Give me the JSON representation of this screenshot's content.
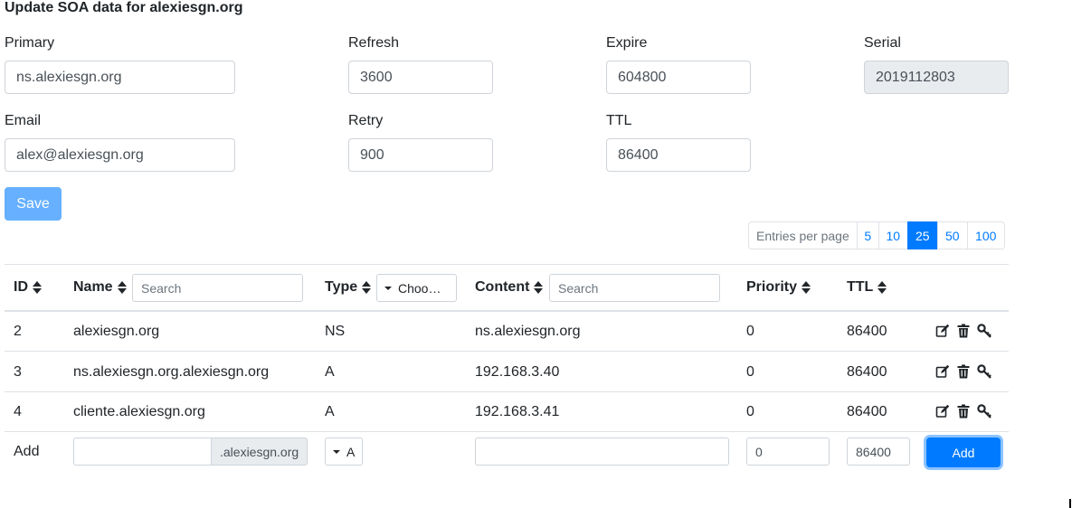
{
  "title": "Update SOA data for alexiesgn.org",
  "soa": {
    "primary": {
      "label": "Primary",
      "value": "ns.alexiesgn.org"
    },
    "refresh": {
      "label": "Refresh",
      "value": "3600"
    },
    "expire": {
      "label": "Expire",
      "value": "604800"
    },
    "serial": {
      "label": "Serial",
      "value": "2019112803"
    },
    "email": {
      "label": "Email",
      "value": "alex@alexiesgn.org"
    },
    "retry": {
      "label": "Retry",
      "value": "900"
    },
    "ttl": {
      "label": "TTL",
      "value": "86400"
    },
    "save_label": "Save"
  },
  "pager": {
    "label": "Entries per page",
    "options": [
      "5",
      "10",
      "25",
      "50",
      "100"
    ],
    "active": "25"
  },
  "table": {
    "headers": {
      "id": "ID",
      "name": "Name",
      "type": "Type",
      "content": "Content",
      "priority": "Priority",
      "ttl": "TTL"
    },
    "name_search_placeholder": "Search",
    "type_filter_label": "Choo…",
    "content_search_placeholder": "Search",
    "rows": [
      {
        "id": "2",
        "name": "alexiesgn.org",
        "type": "NS",
        "content": "ns.alexiesgn.org",
        "priority": "0",
        "ttl": "86400"
      },
      {
        "id": "3",
        "name": "ns.alexiesgn.org.alexiesgn.org",
        "type": "A",
        "content": "192.168.3.40",
        "priority": "0",
        "ttl": "86400"
      },
      {
        "id": "4",
        "name": "cliente.alexiesgn.org",
        "type": "A",
        "content": "192.168.3.41",
        "priority": "0",
        "ttl": "86400"
      }
    ],
    "add_row": {
      "label": "Add",
      "name_value": "",
      "name_suffix": ".alexiesgn.org",
      "type_value": "A",
      "content_value": "",
      "priority_value": "0",
      "ttl_value": "86400",
      "button_label": "Add"
    }
  },
  "icons": {
    "edit": "edit-icon",
    "delete": "trash-icon",
    "key": "key-icon"
  },
  "colors": {
    "primary": "#007bff",
    "save_disabled": "#66b0ff",
    "readonly_bg": "#e9ecef",
    "border": "#ced4da"
  }
}
